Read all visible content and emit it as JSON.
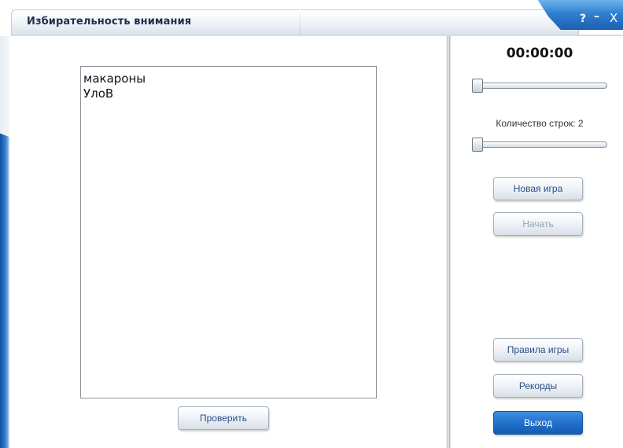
{
  "window": {
    "title": "Избирательность внимания",
    "controls": {
      "help": "?",
      "minimize": "–",
      "close": "X"
    }
  },
  "game_text": {
    "lines": [
      "макароны",
      "УлоВ"
    ]
  },
  "timer": "00:00:00",
  "speed_slider": {
    "value": 0
  },
  "rows": {
    "label": "Количество строк: 2",
    "slider_value": 0
  },
  "buttons": {
    "new_game": "Новая игра",
    "start": "Начать",
    "check": "Проверить",
    "rules": "Правила игры",
    "records": "Рекорды",
    "exit": "Выход"
  },
  "colors": {
    "accent": "#1f6ec9",
    "title_text": "#1f2f4d",
    "button_text": "#2b4f8a"
  }
}
